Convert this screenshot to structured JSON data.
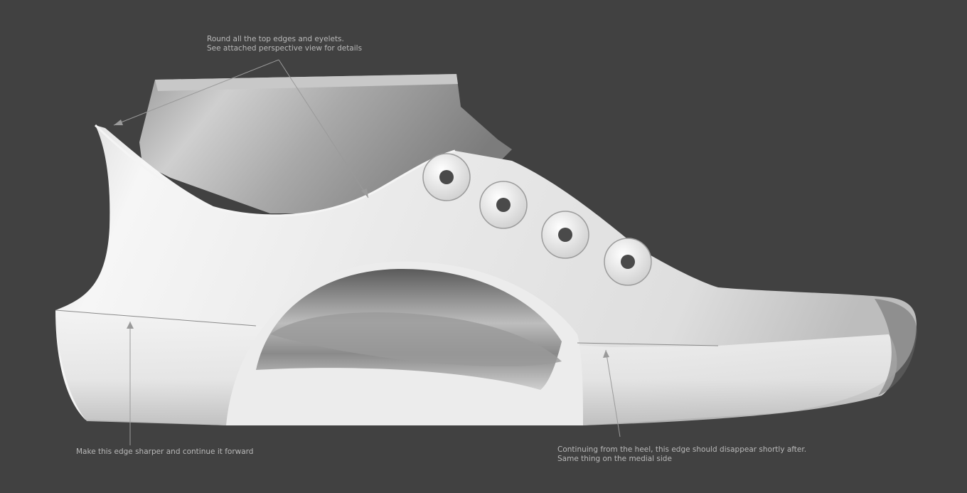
{
  "annotations": {
    "top_edges": {
      "line1": "Round all the top edges and eyelets.",
      "line2": "See attached perspective view for details"
    },
    "heel_edge": {
      "line1": "Make this edge sharper and continue it forward"
    },
    "medial_edge": {
      "line1": "Continuing from the heel, this edge should disappear shortly after.",
      "line2": "Same thing on the medial side"
    }
  },
  "colors": {
    "background": "#414141",
    "model": "#e6e6e6",
    "annotation_text": "#b9b9b9",
    "leader_line": "#9a9a9a"
  }
}
